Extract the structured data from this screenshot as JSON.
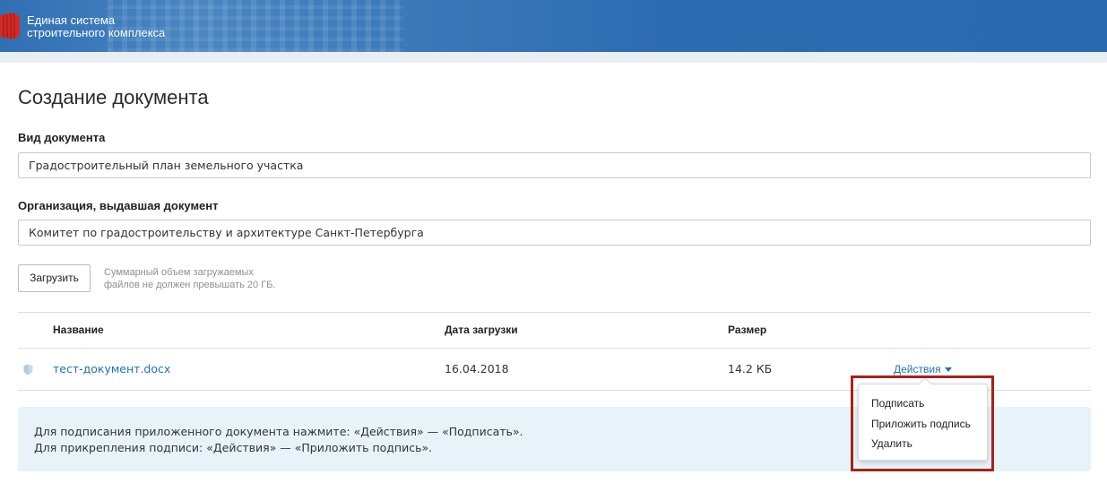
{
  "header": {
    "title_line1": "Единая система",
    "title_line2": "строительного комплекса",
    "brand_color": "#2f6fb3",
    "logo_color": "#d42a24"
  },
  "page": {
    "title": "Создание документа"
  },
  "form": {
    "doc_type_label": "Вид документа",
    "doc_type_value": "Градостроительный план земельного участка",
    "org_label": "Организация, выдавшая документ",
    "org_value": "Комитет по градостроительству и архитектуре Санкт-Петербурга"
  },
  "upload": {
    "button_label": "Загрузить",
    "hint_line1": "Суммарный объем загружаемых",
    "hint_line2": "файлов не должен превышать 20 ГБ."
  },
  "table": {
    "columns": [
      "Название",
      "Дата загрузки",
      "Размер"
    ],
    "rows": [
      {
        "icon": "shield-icon",
        "name": "тест-документ.docx",
        "date": "16.04.2018",
        "size": "14.2 КБ",
        "actions_label": "Действия"
      }
    ]
  },
  "actions_menu": {
    "items": [
      "Подписать",
      "Приложить подпись",
      "Удалить"
    ]
  },
  "info": {
    "line1": "Для подписания приложенного документа нажмите: «Действия» — «Подписать».",
    "line2": "Для прикрепления подписи: «Действия» — «Приложить подпись»."
  }
}
